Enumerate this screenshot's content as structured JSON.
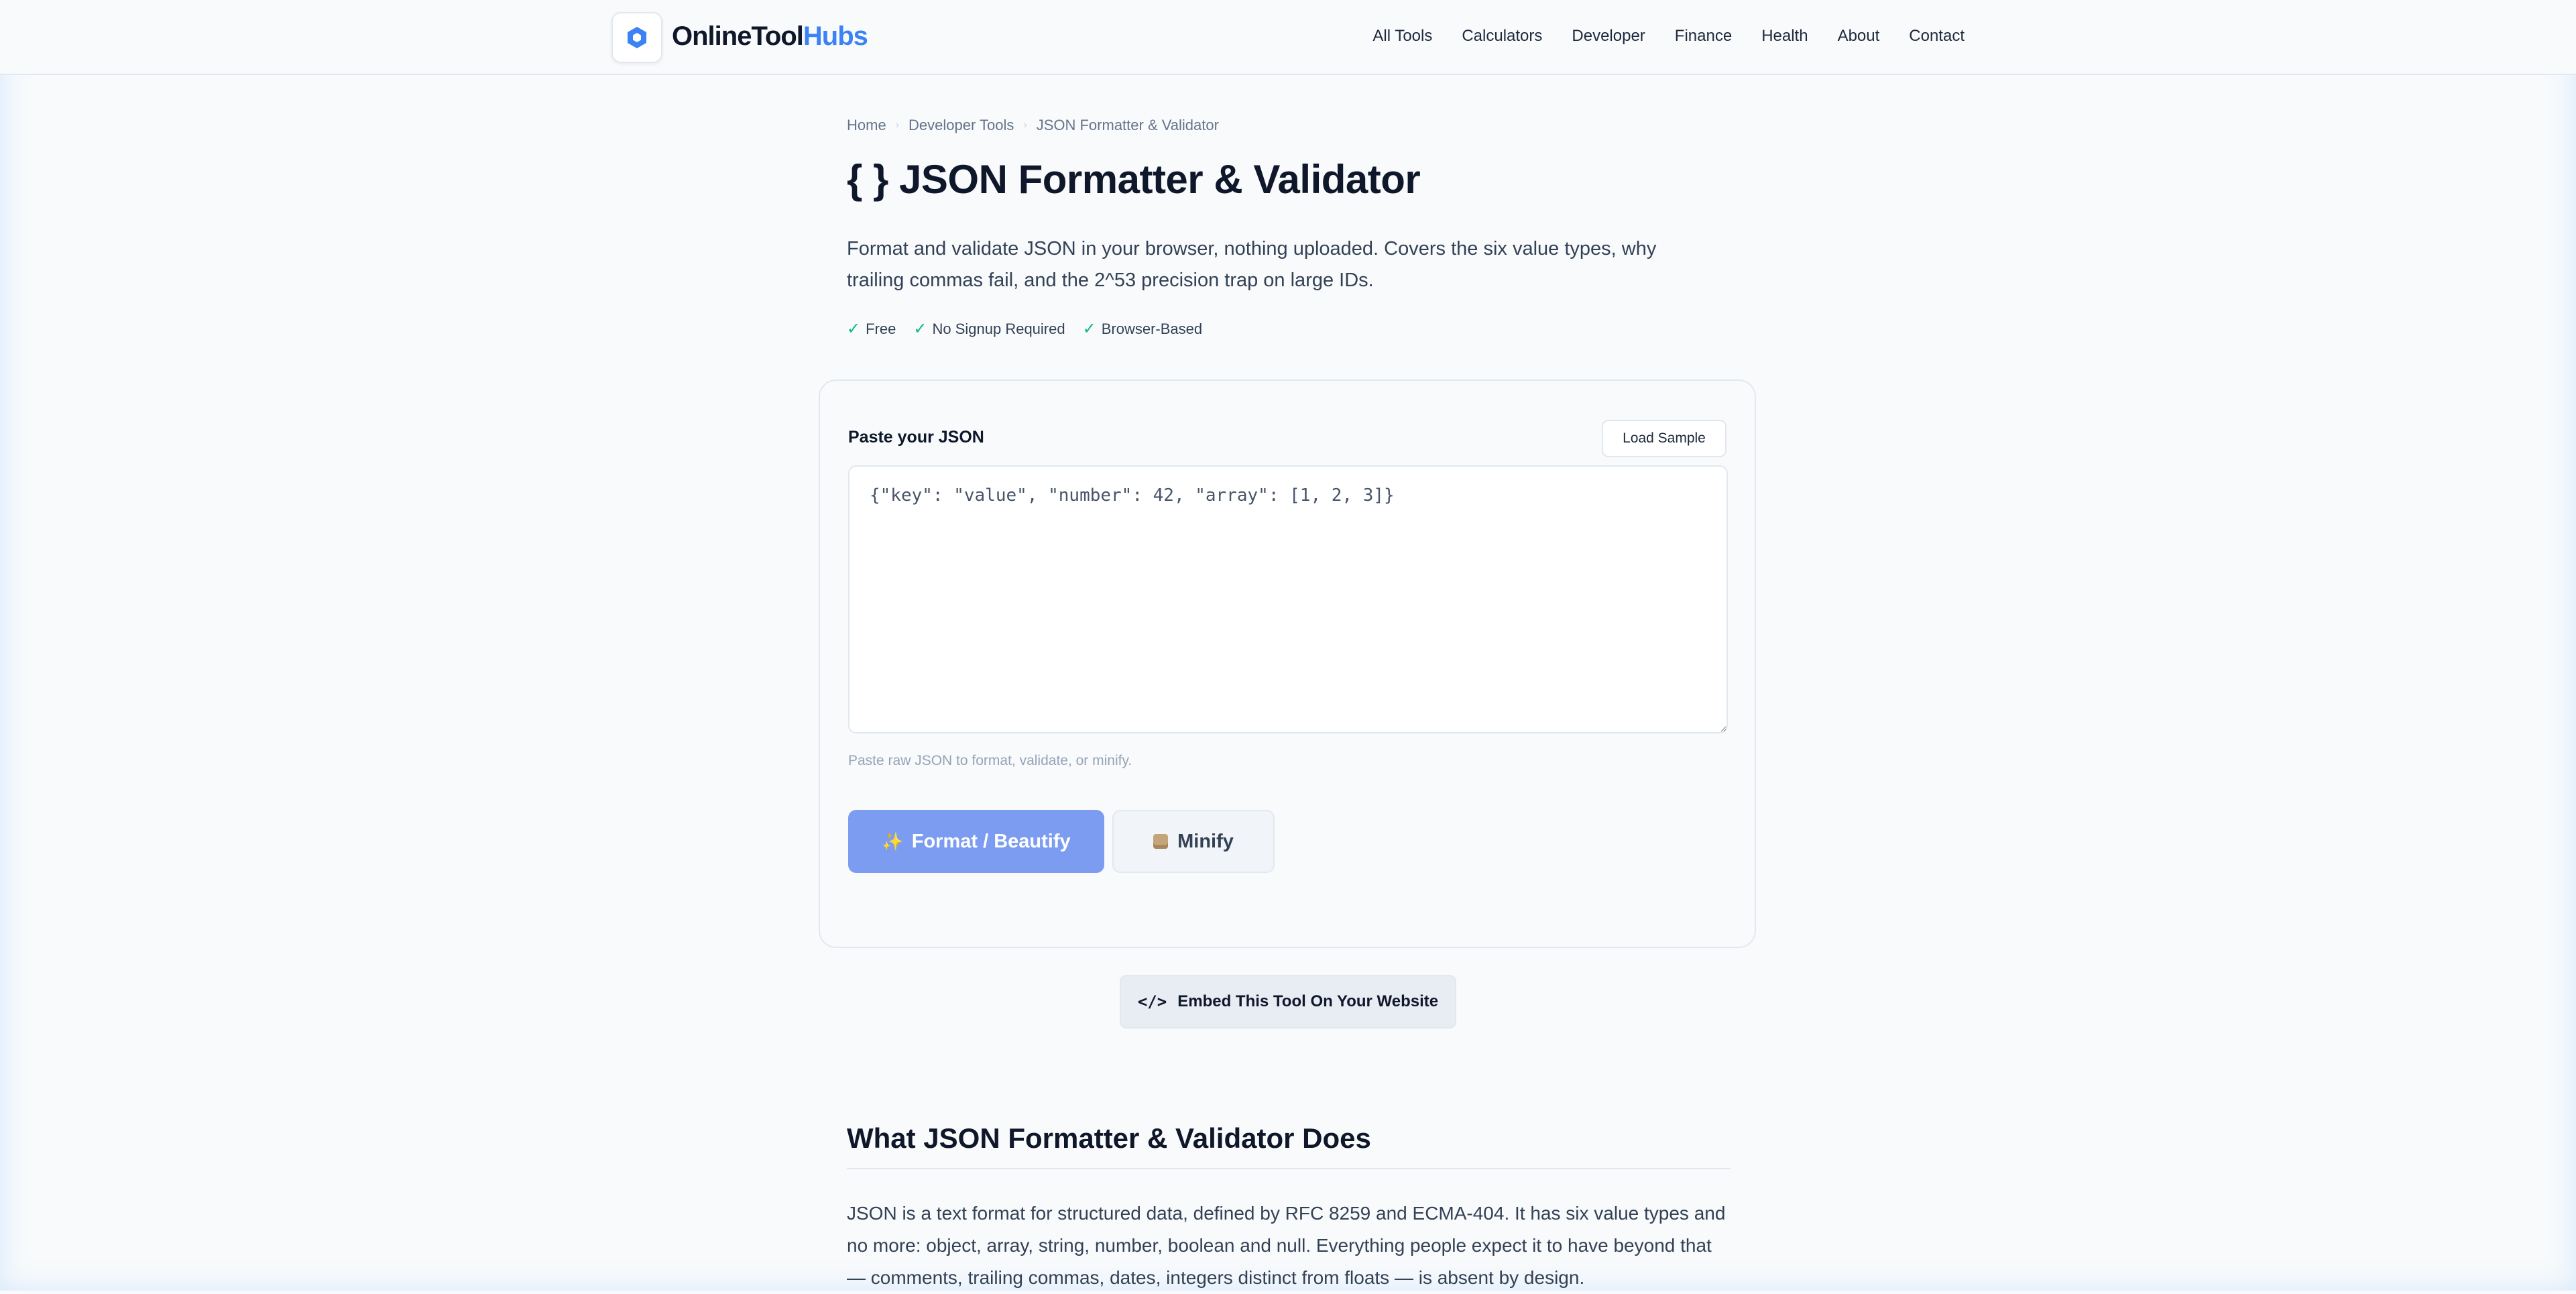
{
  "header": {
    "brand_part1": "OnlineTool",
    "brand_part2": "Hubs",
    "nav": [
      "All Tools",
      "Calculators",
      "Developer",
      "Finance",
      "Health",
      "About",
      "Contact"
    ]
  },
  "breadcrumb": [
    "Home",
    "Developer Tools",
    "JSON Formatter & Validator"
  ],
  "page": {
    "title": "{ } JSON Formatter & Validator",
    "intro": "Format and validate JSON in your browser, nothing uploaded. Covers the six value types, why trailing commas fail, and the 2^53 precision trap on large IDs.",
    "badges": [
      "Free",
      "No Signup Required",
      "Browser-Based"
    ]
  },
  "tool": {
    "label": "Paste your JSON",
    "load_sample": "Load Sample",
    "placeholder": "{\"key\": \"value\", \"number\": 42, \"array\": [1, 2, 3]}",
    "hint": "Paste raw JSON to format, validate, or minify.",
    "format_label": "Format / Beautify",
    "minify_label": "Minify"
  },
  "embed": {
    "label": "Embed This Tool On Your Website",
    "icon_text": "</>"
  },
  "section": {
    "title": "What JSON Formatter & Validator Does",
    "body": "JSON is a text format for structured data, defined by RFC 8259 and ECMA-404. It has six value types and no more: object, array, string, number, boolean and null. Everything people expect it to have beyond that — comments, trailing commas, dates, integers distinct from floats — is absent by design."
  },
  "colors": {
    "accent": "#3b82f6",
    "primary_button": "#7b9cf0",
    "check": "#10b981"
  }
}
